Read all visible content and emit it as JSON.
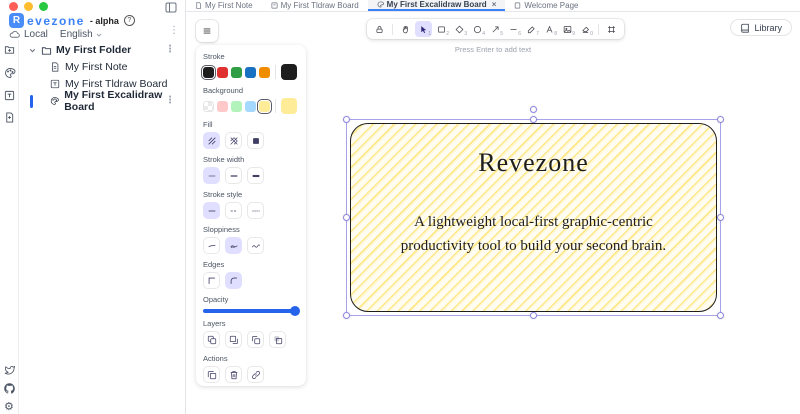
{
  "window": {
    "traffic_lights": [
      "#ff5f57",
      "#febc2e",
      "#28c840"
    ]
  },
  "glyphs": {
    "more_vertical": "⋮",
    "gear": "⚙",
    "help": "?",
    "close": "×"
  },
  "sidebar": {
    "logo": {
      "letter": "R",
      "name": "evezone",
      "suffix": "- alpha"
    },
    "storage_label": "Local",
    "language_label": "English",
    "tree": {
      "folder_label": "My First Folder",
      "items": [
        {
          "label": "My First Note",
          "icon": "note-icon",
          "selected": false
        },
        {
          "label": "My First Tldraw Board",
          "icon": "tldraw-board-icon",
          "selected": false
        },
        {
          "label": "My First Excalidraw Board",
          "icon": "palette-icon",
          "selected": true
        }
      ]
    },
    "footer_icons": [
      "twitter-icon",
      "github-icon",
      "settings-gear-icon"
    ]
  },
  "tabs": [
    {
      "label": "My First Note",
      "active": false
    },
    {
      "label": "My First Tldraw Board",
      "active": false
    },
    {
      "label": "My First Excalidraw Board",
      "active": true
    },
    {
      "label": "Welcome Page",
      "active": false
    }
  ],
  "toolbar": {
    "tools": [
      {
        "name": "lock",
        "shortcut": ""
      },
      {
        "name": "hand",
        "shortcut": ""
      },
      {
        "name": "selection",
        "shortcut": "1",
        "active": true
      },
      {
        "name": "rectangle",
        "shortcut": "2"
      },
      {
        "name": "diamond",
        "shortcut": "3"
      },
      {
        "name": "ellipse",
        "shortcut": "4"
      },
      {
        "name": "arrow",
        "shortcut": "5"
      },
      {
        "name": "line",
        "shortcut": "6"
      },
      {
        "name": "draw",
        "shortcut": "7"
      },
      {
        "name": "text",
        "shortcut": "8"
      },
      {
        "name": "image",
        "shortcut": "9"
      },
      {
        "name": "eraser",
        "shortcut": "0"
      },
      {
        "name": "more-tools",
        "shortcut": ""
      }
    ],
    "hint": "Press Enter to add text",
    "library_label": "Library"
  },
  "panel": {
    "stroke": {
      "label": "Stroke",
      "colors": [
        "#1e1e1e",
        "#e03131",
        "#2f9e44",
        "#1971c2",
        "#f08c00"
      ],
      "current": "#1e1e1e",
      "selected_index": 0
    },
    "background": {
      "label": "Background",
      "colors": [
        "transparent",
        "#ffc9c9",
        "#b2f2bb",
        "#a5d8ff",
        "#ffec99"
      ],
      "current": "#ffec99",
      "selected_index": 4
    },
    "fill": {
      "label": "Fill",
      "options": [
        "hachure",
        "cross-hatch",
        "solid"
      ],
      "selected": "hachure"
    },
    "stroke_width": {
      "label": "Stroke width",
      "options": [
        "thin",
        "bold",
        "extra-bold"
      ],
      "selected": "thin"
    },
    "stroke_style": {
      "label": "Stroke style",
      "options": [
        "solid",
        "dashed",
        "dotted"
      ],
      "selected": "solid"
    },
    "sloppiness": {
      "label": "Sloppiness",
      "options": [
        "architect",
        "artist",
        "cartoonist"
      ],
      "selected": "artist"
    },
    "edges": {
      "label": "Edges",
      "options": [
        "sharp",
        "round"
      ],
      "selected": "round"
    },
    "opacity": {
      "label": "Opacity",
      "value": 100
    },
    "layers": {
      "label": "Layers",
      "options": [
        "send-to-back",
        "send-backward",
        "bring-forward",
        "bring-to-front"
      ]
    },
    "actions": {
      "label": "Actions",
      "options": [
        "duplicate",
        "delete",
        "link"
      ]
    }
  },
  "canvas": {
    "shape": {
      "type": "rectangle",
      "title": "Revezone",
      "body_line1": "A lightweight local-first graphic-centric",
      "body_line2": "productivity tool to build your second brain.",
      "stroke_color": "#1e1e1e",
      "background_color": "#ffec99",
      "fill_style": "hachure",
      "selected": true
    }
  }
}
